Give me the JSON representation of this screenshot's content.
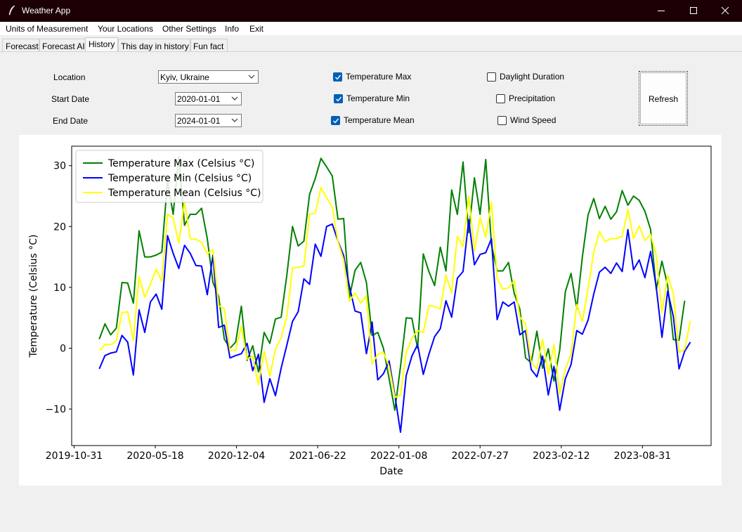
{
  "window": {
    "title": "Weather App"
  },
  "menu": [
    "Units of Measurement",
    "Your Locations",
    "Other Settings",
    "Info",
    "Exit"
  ],
  "tabs": [
    "Forecast",
    "Forecast AI",
    "History",
    "This day in history",
    "Fun fact"
  ],
  "active_tab": "History",
  "form": {
    "location_label": "Location",
    "location_value": "Kyiv, Ukraine",
    "start_label": "Start Date",
    "start_value": "2020-01-01",
    "end_label": "End Date",
    "end_value": "2024-01-01",
    "checkboxes": [
      {
        "label": "Temperature Max",
        "checked": true
      },
      {
        "label": "Temperature Min",
        "checked": true
      },
      {
        "label": "Temperature Mean",
        "checked": true
      },
      {
        "label": "Daylight Duration",
        "checked": false
      },
      {
        "label": "Precipitation",
        "checked": false
      },
      {
        "label": "Wind Speed",
        "checked": false
      }
    ],
    "refresh_label": "Refresh"
  },
  "colors": {
    "titlebar": "#1c0006",
    "check_accent": "#005fb8"
  },
  "chart_data": {
    "type": "line",
    "xlabel": "Date",
    "ylabel": "Temperature (Celsius °C)",
    "x_start": "2020-01-01",
    "x_step_days": 14,
    "x_ticks": [
      "2019-10-31",
      "2020-05-18",
      "2020-12-04",
      "2021-06-22",
      "2022-01-08",
      "2022-07-27",
      "2023-02-12",
      "2023-08-31"
    ],
    "xlim": [
      "2019-10-25",
      "2024-02-16"
    ],
    "y_ticks": [
      -10,
      0,
      10,
      20,
      30
    ],
    "ylim": [
      -16,
      33.2
    ],
    "legend_position": "upper-left",
    "grid": false,
    "series": [
      {
        "name": "Temperature Max (Celsius °C)",
        "color": "#008000",
        "values": [
          1.5,
          4.0,
          2.2,
          3.3,
          10.8,
          10.7,
          7.4,
          19.3,
          15.0,
          15.0,
          15.3,
          15.8,
          27.5,
          22.0,
          31.5,
          20.2,
          22.0,
          22.0,
          23.0,
          18.0,
          10.8,
          8.5,
          1.5,
          0.0,
          1.0,
          6.9,
          -2.0,
          0.4,
          -3.9,
          2.6,
          0.8,
          4.8,
          5.1,
          12.0,
          20.0,
          16.8,
          17.6,
          25.3,
          27.9,
          31.2,
          29.8,
          28.3,
          21.2,
          21.3,
          8.3,
          12.8,
          14.1,
          10.8,
          2.1,
          2.6,
          0.0,
          -5.0,
          -10.2,
          -3.0,
          5.0,
          4.9,
          0.0,
          15.5,
          12.6,
          10.3,
          16.6,
          12.7,
          26.0,
          22.0,
          30.6,
          19.0,
          28.0,
          22.0,
          31.0,
          17.0,
          12.7,
          12.7,
          14.1,
          9.0,
          6.4,
          -1.6,
          -2.4,
          2.8,
          -3.3,
          -0.1,
          -5.4,
          -0.4,
          9.3,
          12.3,
          6.5,
          15.0,
          21.9,
          24.6,
          21.3,
          23.3,
          21.2,
          22.4,
          25.9,
          23.5,
          25.0,
          24.3,
          22.5,
          19.5,
          9.7,
          14.3,
          10.3,
          1.4,
          1.3,
          7.8
        ]
      },
      {
        "name": "Temperature Min (Celsius °C)",
        "color": "#0000ff",
        "values": [
          -3.4,
          -1.2,
          -0.8,
          -0.6,
          2.1,
          1.0,
          -4.4,
          6.3,
          2.6,
          7.6,
          8.9,
          6.4,
          18.5,
          15.6,
          13.1,
          16.9,
          15.6,
          13.6,
          13.5,
          8.8,
          15.3,
          3.4,
          3.8,
          -1.6,
          -1.2,
          -0.9,
          0.8,
          -3.7,
          -1.0,
          -8.9,
          -5.0,
          -7.8,
          -3.3,
          0.5,
          4.4,
          6.0,
          11.4,
          10.5,
          17.1,
          15.1,
          20.0,
          20.4,
          17.6,
          15.2,
          10.2,
          6.1,
          5.8,
          -0.9,
          4.3,
          -5.2,
          -4.2,
          -2.1,
          -7.7,
          -13.8,
          -4.5,
          -1.3,
          0.6,
          -4.3,
          -1.0,
          1.9,
          3.2,
          7.8,
          5.1,
          11.5,
          12.6,
          21.1,
          13.7,
          15.4,
          15.7,
          18.0,
          4.7,
          7.6,
          6.9,
          7.6,
          2.2,
          2.9,
          -3.5,
          -4.7,
          -1.3,
          -7.7,
          -3.0,
          -10.2,
          -5.0,
          -2.7,
          2.9,
          2.3,
          4.6,
          8.9,
          12.5,
          13.3,
          12.3,
          14.0,
          12.6,
          19.5,
          12.9,
          14.5,
          11.6,
          15.9,
          10.0,
          1.8,
          9.4,
          5.2,
          -3.4,
          -0.5,
          1.0
        ]
      },
      {
        "name": "Temperature Mean (Celsius °C)",
        "color": "#ffff00",
        "values": [
          -0.4,
          0.6,
          0.6,
          1.2,
          5.8,
          6.0,
          1.3,
          11.8,
          8.4,
          10.5,
          13.0,
          11.0,
          22.0,
          21.4,
          17.3,
          24.1,
          18.0,
          17.9,
          17.4,
          15.5,
          16.2,
          7.0,
          6.5,
          -0.4,
          -0.3,
          3.6,
          -1.8,
          -1.3,
          -6.0,
          -0.5,
          -4.6,
          -0.2,
          1.7,
          5.2,
          13.2,
          13.3,
          13.5,
          22.0,
          22.2,
          26.4,
          24.7,
          23.2,
          17.5,
          14.5,
          7.7,
          9.1,
          7.4,
          8.6,
          -2.6,
          -1.0,
          -0.7,
          -3.0,
          -8.1,
          -7.7,
          -0.7,
          1.6,
          2.9,
          2.6,
          7.0,
          6.9,
          6.4,
          12.0,
          9.1,
          18.4,
          16.7,
          25.0,
          16.0,
          21.5,
          18.2,
          24.0,
          11.5,
          9.7,
          9.9,
          11.1,
          5.1,
          4.0,
          -2.3,
          -3.4,
          1.5,
          -4.3,
          0.6,
          -7.5,
          -3.4,
          -1.0,
          7.2,
          4.4,
          9.8,
          15.8,
          19.2,
          17.5,
          18.0,
          18.0,
          18.4,
          22.8,
          18.0,
          20.1,
          17.7,
          18.7,
          15.3,
          5.8,
          12.0,
          9.0,
          -0.7,
          -0.2,
          4.5
        ]
      }
    ]
  }
}
